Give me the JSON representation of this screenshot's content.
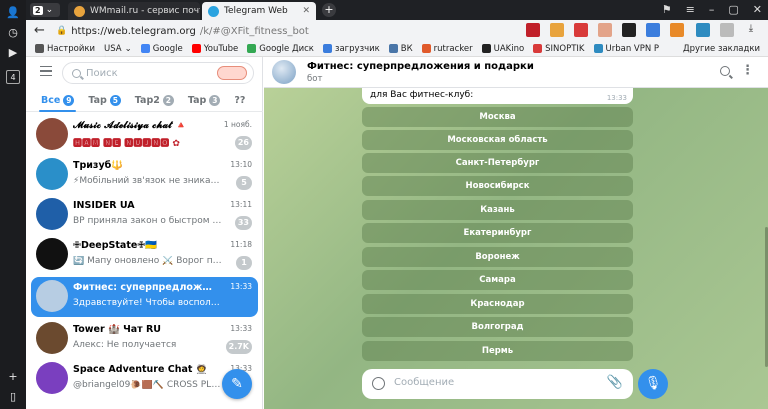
{
  "browser": {
    "tab_count": "2",
    "tabs": [
      {
        "label": "WMmail.ru - сервис почт",
        "favicon_color": "#e8a33d"
      },
      {
        "label": "Telegram Web",
        "favicon_color": "#2aa3e0"
      }
    ],
    "address": {
      "host": "https://web.telegram.org",
      "path": "/k/#@XFit_fitness_bot"
    },
    "bookmarks": [
      {
        "label": "Настройки",
        "icon": "gear-icon",
        "color": "#555555"
      },
      {
        "label": "USA",
        "icon": "chevron-down-icon",
        "color": "#555555"
      },
      {
        "label": "Google",
        "icon": "google-icon",
        "color": "#4285f4"
      },
      {
        "label": "YouTube",
        "icon": "youtube-icon",
        "color": "#ff0000"
      },
      {
        "label": "Google Диск",
        "icon": "drive-icon",
        "color": "#34a853"
      },
      {
        "label": "загрузчик",
        "icon": "download-icon",
        "color": "#3b7ddd"
      },
      {
        "label": "ВК",
        "icon": "vk-icon",
        "color": "#4a76a8"
      },
      {
        "label": "rutracker",
        "icon": "rutracker-icon",
        "color": "#e05a2b"
      },
      {
        "label": "UAKino",
        "icon": "uakino-icon",
        "color": "#222222"
      },
      {
        "label": "SINOPTIK",
        "icon": "sinoptik-icon",
        "color": "#d83a3a"
      },
      {
        "label": "Urban VPN P",
        "icon": "vpn-icon",
        "color": "#2e8bc0"
      }
    ],
    "bookmarks_other": "Другие закладки"
  },
  "sidebar": {
    "search_placeholder": "Поиск",
    "folders": [
      {
        "label": "Все",
        "badge": "9",
        "active": true
      },
      {
        "label": "Tap",
        "badge": "5"
      },
      {
        "label": "Tap2",
        "badge": "2"
      },
      {
        "label": "Tap",
        "badge": "3"
      },
      {
        "label": "??",
        "badge": ""
      }
    ],
    "chats": [
      {
        "name": "𝓜𝓾𝓼𝓲𝓬 𝓐𝓭𝓮𝓵𝓲𝓼𝓲𝔂𝓪 𝓬𝓱𝓪𝓽 🔺",
        "preview": "🅷🅰🅼 🅽🅴 🅽🆄🅹🅽🅾 ✿",
        "time": "1 нояб.",
        "count": "26",
        "avatar_color": "#8a4a3a"
      },
      {
        "name": "Тризуб🔱",
        "preview": "⚡Мобільний зв'язок не зникати...",
        "time": "13:10",
        "count": "5",
        "avatar_color": "#2a8fc9"
      },
      {
        "name": "INSIDER UA",
        "preview": "ВР приняла закон о быстром мо...",
        "time": "13:11",
        "count": "33",
        "avatar_color": "#1f5fa8"
      },
      {
        "name": "✙DeepState✙🇺🇦",
        "preview": "🔄 Мапу оновлено ⚔️ Ворог прос...",
        "time": "11:18",
        "count": "1",
        "avatar_color": "#111111"
      },
      {
        "name": "Фитнес: суперпредложения и пода...",
        "preview": "Здравствуйте! Чтобы воспользоваться а...",
        "time": "13:33",
        "count": "",
        "avatar_color": "#b7cde3",
        "selected": true
      },
      {
        "name": "Tower 🏰 Чат RU",
        "preview": "Алекс: Не получается",
        "time": "13:33",
        "count": "2.7K",
        "avatar_color": "#6b4a2f"
      },
      {
        "name": "Space Adventure Chat 🧑‍🚀",
        "preview": "@briangel09🐌🟫⛏️ CROSS PLAY: Ho...",
        "time": "13:33",
        "count": "",
        "avatar_color": "#7a3fbf"
      }
    ]
  },
  "chat": {
    "title": "Фитнес: суперпредложения и подарки",
    "subtitle": "бот",
    "message_tail": "для Вас фитнес-клуб:",
    "message_time": "13:33",
    "city_buttons": [
      "Москва",
      "Московская область",
      "Санкт-Петербург",
      "Новосибирск",
      "Казань",
      "Екатеринбург",
      "Воронеж",
      "Самара",
      "Краснодар",
      "Волгоград",
      "Пермь"
    ],
    "composer_placeholder": "Сообщение"
  }
}
